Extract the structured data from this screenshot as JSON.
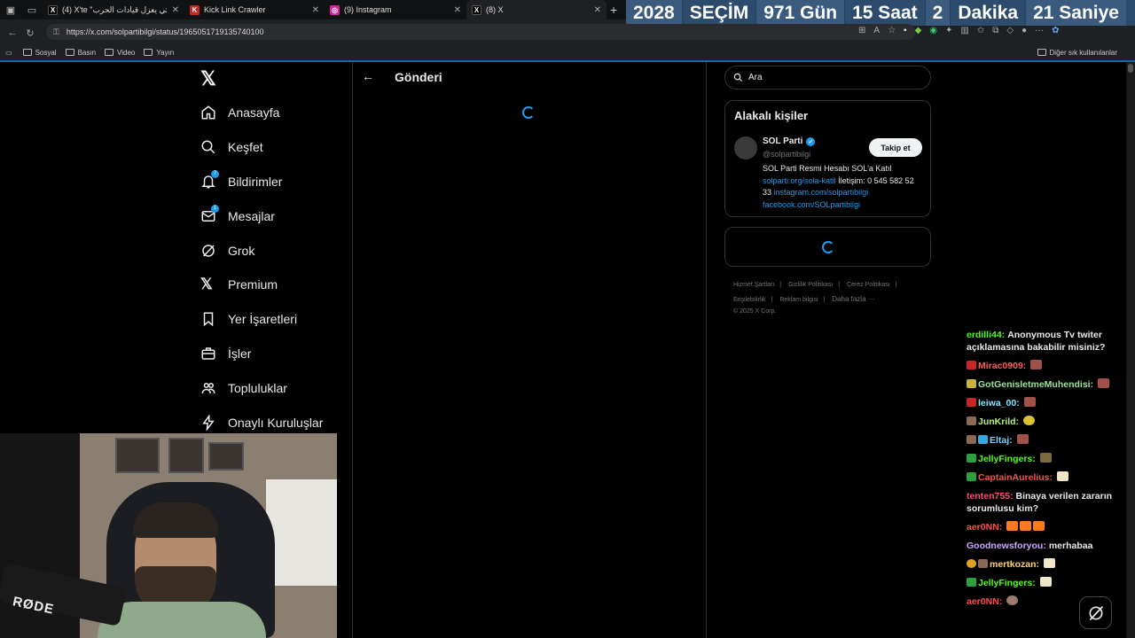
{
  "browser": {
    "tabs": [
      {
        "label": "(4) X'te \"قضائي يعزل قيادات الحرب\"",
        "fav_color": "#000000",
        "fav_text": "X"
      },
      {
        "label": "Kick Link Crawler",
        "fav_color": "#c62828",
        "fav_text": "K"
      },
      {
        "label": "(9) Instagram",
        "fav_color": "#d6249f",
        "fav_text": "◎"
      },
      {
        "label": "(8) X",
        "fav_color": "#000000",
        "fav_text": "X"
      }
    ],
    "url": "https://x.com/solpartibilgi/status/1965051719135740100",
    "bookmarks": [
      "Sosyal",
      "Basın",
      "Video",
      "Yayın"
    ],
    "other_bookmarks": "Diğer sık kullanılanlar"
  },
  "countdown": {
    "segments": [
      "2028",
      "SEÇİM",
      "971 Gün",
      "15 Saat",
      "2",
      "Dakika",
      "21 Saniye"
    ]
  },
  "nav": {
    "items": [
      {
        "label": "Anasayfa",
        "icon": "home-icon"
      },
      {
        "label": "Keşfet",
        "icon": "search-icon"
      },
      {
        "label": "Bildirimler",
        "icon": "bell-icon",
        "badge": "7"
      },
      {
        "label": "Mesajlar",
        "icon": "mail-icon",
        "badge": "1"
      },
      {
        "label": "Grok",
        "icon": "grok-icon"
      },
      {
        "label": "Premium",
        "icon": "x-premium-icon"
      },
      {
        "label": "Yer İşaretleri",
        "icon": "bookmark-icon"
      },
      {
        "label": "İşler",
        "icon": "briefcase-icon"
      },
      {
        "label": "Topluluklar",
        "icon": "people-icon"
      },
      {
        "label": "Onaylı Kuruluşlar",
        "icon": "lightning-icon"
      }
    ]
  },
  "main": {
    "title": "Gönderi"
  },
  "right": {
    "search_placeholder": "Ara",
    "relevant_title": "Alakalı kişiler",
    "person": {
      "name": "SOL Parti",
      "handle": "@solpartibilgi",
      "follow_label": "Takip et",
      "bio_text1": "SOL Parti Resmi Hesabı SOL'a Katıl",
      "bio_link1": "solparti.org/sola-katil",
      "bio_text2": "İletişim: 0 545 582 52 33",
      "bio_link2": "instagram.com/solpartibilgi",
      "bio_link3": "facebook.com/SOLpartibilgi"
    },
    "footer": {
      "links": [
        "Hizmet Şartları",
        "Gizlilik Politikası",
        "Çerez Politikası",
        "Erişilebilirlik",
        "Reklam bilgisi",
        "Daha fazla ···"
      ],
      "copyright": "© 2025 X Corp."
    }
  },
  "chat": {
    "messages": [
      {
        "user": "erdilli44:",
        "color": "#53fc18",
        "text": "Anonymous Tv twiter açıklamasına bakabilir misiniz?"
      },
      {
        "user": "Mirac0909:",
        "color": "#ff5c5c",
        "text": ""
      },
      {
        "user": "GotGenisletmeMuhendisi:",
        "color": "#9be59b",
        "text": ""
      },
      {
        "user": "leiwa_00:",
        "color": "#7fe8ff",
        "text": ""
      },
      {
        "user": "JunKrild:",
        "color": "#b5f27c",
        "text": ""
      },
      {
        "user": "Eltaj:",
        "color": "#7fd0ff",
        "text": ""
      },
      {
        "user": "JellyFingers:",
        "color": "#53fc18",
        "text": ""
      },
      {
        "user": "CaptainAurelius:",
        "color": "#ff4d4d",
        "text": ""
      },
      {
        "user": "tenten755:",
        "color": "#ff4d6d",
        "text": "Binaya verilen zararın sorumlusu kim?"
      },
      {
        "user": "aer0NN:",
        "color": "#ff4d4d",
        "text": ""
      },
      {
        "user": "Goodnewsforyou:",
        "color": "#c9a7ff",
        "text": "merhabaa"
      },
      {
        "user": "mertkozan:",
        "color": "#ffd36b",
        "text": ""
      },
      {
        "user": "JellyFingers:",
        "color": "#53fc18",
        "text": ""
      },
      {
        "user": "aer0NN:",
        "color": "#ff4d4d",
        "text": ""
      }
    ]
  },
  "webcam_logo": "RØDE"
}
